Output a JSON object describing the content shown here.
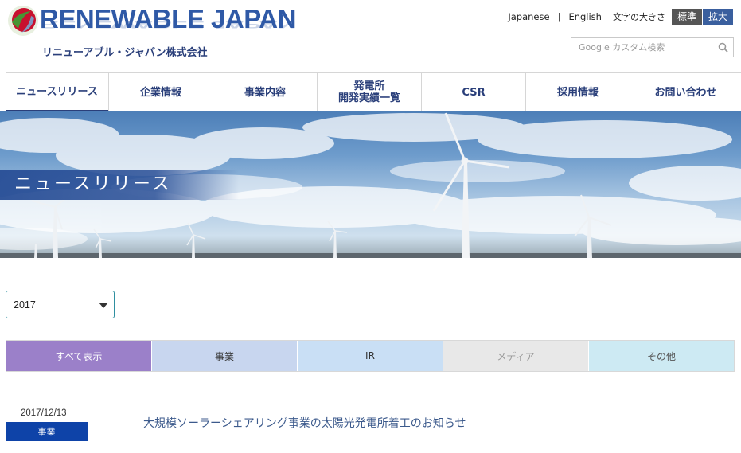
{
  "brand": {
    "logo_text": "RENEWABLE JAPAN",
    "company_name": "リニューアブル・ジャパン株式会社",
    "colors": {
      "primary": "#2f59a6",
      "navy": "#2a3f7a",
      "logo_red": "#c8102e",
      "logo_green": "#3aa335"
    }
  },
  "header": {
    "languages": [
      "Japanese",
      "English"
    ],
    "font_size_label": "文字の大きさ",
    "font_size_standard": "標準",
    "font_size_large": "拡大",
    "search": {
      "placeholder": "Google カスタム検索",
      "icon": "search-icon"
    }
  },
  "nav": {
    "items": [
      {
        "label": "ニュースリリース"
      },
      {
        "label": "企業情報"
      },
      {
        "label": "事業内容"
      },
      {
        "label": "発電所\n開発実績一覧"
      },
      {
        "label": "CSR"
      },
      {
        "label": "採用情報"
      },
      {
        "label": "お問い合わせ"
      }
    ]
  },
  "hero": {
    "title": "ニュースリリース"
  },
  "year_filter": {
    "selected": "2017"
  },
  "categories": [
    {
      "label": "すべて表示",
      "bg": "#9b80c9",
      "color": "#ffffff"
    },
    {
      "label": "事業",
      "bg": "#c8d6ef",
      "color": "#333333"
    },
    {
      "label": "IR",
      "bg": "#c9dff5",
      "color": "#333333"
    },
    {
      "label": "メディア",
      "bg": "#e8e8e8",
      "color": "#999999"
    },
    {
      "label": "その他",
      "bg": "#cdeaf3",
      "color": "#555555"
    }
  ],
  "news": [
    {
      "date": "2017/12/13",
      "category": "事業",
      "title": "大規模ソーラーシェアリング事業の太陽光発電所着工のお知らせ",
      "badge_color": "#0e43a8"
    }
  ]
}
